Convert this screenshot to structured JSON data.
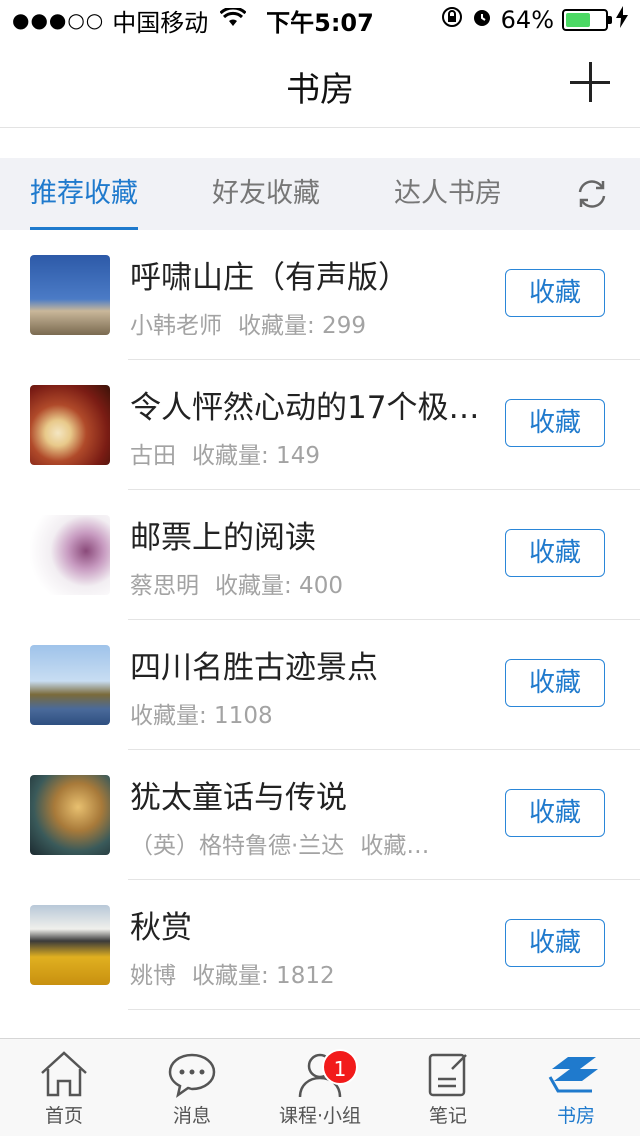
{
  "status_bar": {
    "signal": "●●●○○",
    "carrier": "中国移动",
    "time": "下午5:07",
    "battery": "64%",
    "battery_level": 0.64
  },
  "header": {
    "title": "书房"
  },
  "tabs": [
    {
      "label": "推荐收藏",
      "active": true
    },
    {
      "label": "好友收藏",
      "active": false
    },
    {
      "label": "达人书房",
      "active": false
    }
  ],
  "items": [
    {
      "title": "呼啸山庄（有声版）",
      "author": "小韩老师",
      "count": "收藏量: 299",
      "action": "收藏"
    },
    {
      "title": "令人怦然心动的17个极…",
      "author": "古田",
      "count": "收藏量: 149",
      "action": "收藏"
    },
    {
      "title": "邮票上的阅读",
      "author": "蔡思明",
      "count": "收藏量: 400",
      "action": "收藏"
    },
    {
      "title": "四川名胜古迹景点",
      "author": "",
      "count": "收藏量: 1108",
      "action": "收藏"
    },
    {
      "title": "犹太童话与传说",
      "author": "（英）格特鲁德·兰达",
      "count": "收藏…",
      "action": "收藏"
    },
    {
      "title": "秋赏",
      "author": "姚博",
      "count": "收藏量: 1812",
      "action": "收藏"
    }
  ],
  "tabbar": [
    {
      "label": "首页",
      "icon": "home-icon",
      "active": false
    },
    {
      "label": "消息",
      "icon": "message-icon",
      "active": false
    },
    {
      "label": "课程·小组",
      "icon": "person-icon",
      "active": false,
      "badge": "1"
    },
    {
      "label": "笔记",
      "icon": "note-icon",
      "active": false
    },
    {
      "label": "书房",
      "icon": "books-icon",
      "active": true
    }
  ],
  "colors": {
    "accent": "#1f7acd",
    "badge": "#f21b1b",
    "battery": "#4cd964"
  }
}
